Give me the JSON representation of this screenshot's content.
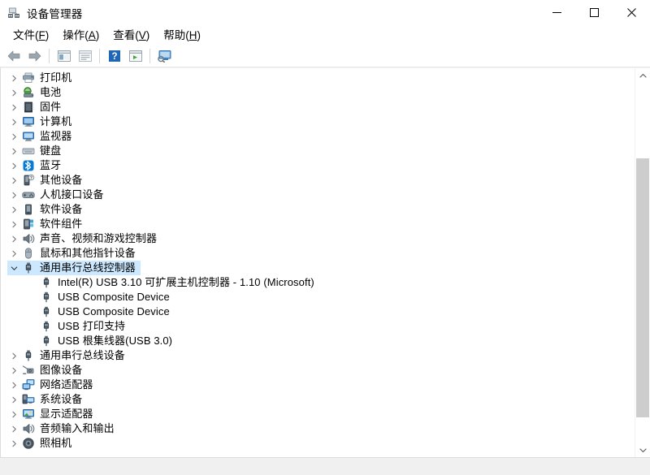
{
  "window": {
    "title": "设备管理器",
    "icon": "device-manager-icon",
    "controls": {
      "minimize": "最小化",
      "maximize": "最大化",
      "close": "关闭"
    }
  },
  "menubar": {
    "items": [
      {
        "label": "文件",
        "accel": "F"
      },
      {
        "label": "操作",
        "accel": "A"
      },
      {
        "label": "查看",
        "accel": "V"
      },
      {
        "label": "帮助",
        "accel": "H"
      }
    ]
  },
  "toolbar": {
    "buttons": [
      {
        "name": "back-arrow-icon",
        "tooltip": "后退"
      },
      {
        "name": "forward-arrow-icon",
        "tooltip": "前进"
      },
      {
        "name": "show-hide-console-tree-icon",
        "tooltip": "显示/隐藏控制台树"
      },
      {
        "name": "properties-icon",
        "tooltip": "属性"
      },
      {
        "name": "help-icon",
        "tooltip": "帮助"
      },
      {
        "name": "update-driver-icon",
        "tooltip": "更新驱动程序"
      },
      {
        "name": "scan-hardware-changes-icon",
        "tooltip": "扫描检测硬件改动"
      }
    ]
  },
  "tree": {
    "rows": [
      {
        "label": "打印机",
        "level": 1,
        "state": "collapsed",
        "icon": "printer-icon",
        "selected": false
      },
      {
        "label": "电池",
        "level": 1,
        "state": "collapsed",
        "icon": "battery-icon",
        "selected": false
      },
      {
        "label": "固件",
        "level": 1,
        "state": "collapsed",
        "icon": "firmware-icon",
        "selected": false
      },
      {
        "label": "计算机",
        "level": 1,
        "state": "collapsed",
        "icon": "computer-icon",
        "selected": false
      },
      {
        "label": "监视器",
        "level": 1,
        "state": "collapsed",
        "icon": "monitor-icon",
        "selected": false
      },
      {
        "label": "键盘",
        "level": 1,
        "state": "collapsed",
        "icon": "keyboard-icon",
        "selected": false
      },
      {
        "label": "蓝牙",
        "level": 1,
        "state": "collapsed",
        "icon": "bluetooth-icon",
        "selected": false
      },
      {
        "label": "其他设备",
        "level": 1,
        "state": "collapsed",
        "icon": "other-devices-icon",
        "selected": false
      },
      {
        "label": "人机接口设备",
        "level": 1,
        "state": "collapsed",
        "icon": "hid-icon",
        "selected": false
      },
      {
        "label": "软件设备",
        "level": 1,
        "state": "collapsed",
        "icon": "software-device-icon",
        "selected": false
      },
      {
        "label": "软件组件",
        "level": 1,
        "state": "collapsed",
        "icon": "software-component-icon",
        "selected": false
      },
      {
        "label": "声音、视频和游戏控制器",
        "level": 1,
        "state": "collapsed",
        "icon": "sound-icon",
        "selected": false
      },
      {
        "label": "鼠标和其他指针设备",
        "level": 1,
        "state": "collapsed",
        "icon": "mouse-icon",
        "selected": false
      },
      {
        "label": "通用串行总线控制器",
        "level": 1,
        "state": "expanded",
        "icon": "usb-icon",
        "selected": true
      },
      {
        "label": "Intel(R) USB 3.10 可扩展主机控制器 - 1.10 (Microsoft)",
        "level": 2,
        "state": "leaf",
        "icon": "usb-plug-icon",
        "selected": false
      },
      {
        "label": "USB Composite Device",
        "level": 2,
        "state": "leaf",
        "icon": "usb-plug-icon",
        "selected": false
      },
      {
        "label": "USB Composite Device",
        "level": 2,
        "state": "leaf",
        "icon": "usb-plug-icon",
        "selected": false
      },
      {
        "label": "USB 打印支持",
        "level": 2,
        "state": "leaf",
        "icon": "usb-plug-icon",
        "selected": false
      },
      {
        "label": "USB 根集线器(USB 3.0)",
        "level": 2,
        "state": "leaf",
        "icon": "usb-plug-icon",
        "selected": false
      },
      {
        "label": "通用串行总线设备",
        "level": 1,
        "state": "collapsed",
        "icon": "usb-icon",
        "selected": false
      },
      {
        "label": "图像设备",
        "level": 1,
        "state": "collapsed",
        "icon": "imaging-icon",
        "selected": false
      },
      {
        "label": "网络适配器",
        "level": 1,
        "state": "collapsed",
        "icon": "network-icon",
        "selected": false
      },
      {
        "label": "系统设备",
        "level": 1,
        "state": "collapsed",
        "icon": "system-device-icon",
        "selected": false
      },
      {
        "label": "显示适配器",
        "level": 1,
        "state": "collapsed",
        "icon": "display-adapter-icon",
        "selected": false
      },
      {
        "label": "音频输入和输出",
        "level": 1,
        "state": "collapsed",
        "icon": "audio-io-icon",
        "selected": false
      },
      {
        "label": "照相机",
        "level": 1,
        "state": "collapsed",
        "icon": "camera-icon",
        "selected": false
      }
    ]
  },
  "scrollbar": {
    "up_arrow": "scroll-up-icon",
    "down_arrow": "scroll-down-icon",
    "thumb_top_percent": 21,
    "thumb_height_percent": 72
  },
  "colors": {
    "selection": "#cce8ff",
    "bluetooth": "#0a7bd4",
    "status_bar": "#f0f0f0",
    "scroll_thumb": "#cdcdcd"
  }
}
